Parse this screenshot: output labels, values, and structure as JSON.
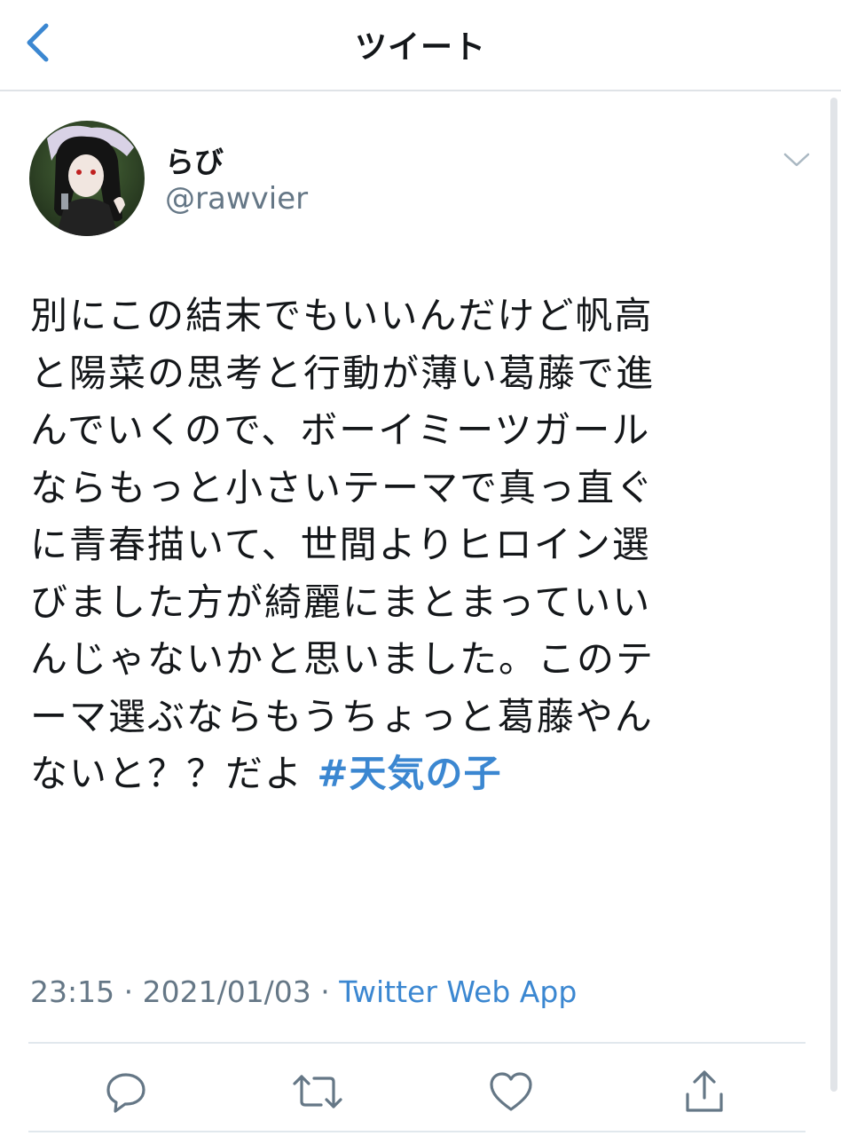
{
  "header": {
    "title": "ツイート",
    "back_icon": "chevron-left-icon"
  },
  "colors": {
    "accent": "#3b87d1",
    "text": "#14171a",
    "muted": "#657786",
    "divider": "#e1e8ed"
  },
  "tweet": {
    "author": {
      "display_name": "らび",
      "handle": "@rawvier"
    },
    "text_lines": [
      "別にこの結末でもいいんだけど帆高",
      "と陽菜の思考と行動が薄い葛藤で進",
      "んでいくので、ボーイミーツガール",
      "ならもっと小さいテーマで真っ直ぐ",
      "に青春描いて、世間よりヒロイン選",
      "びました方が綺麗にまとまっていい",
      "んじゃないかと思いました。このテ",
      "ーマ選ぶならもうちょっと葛藤やん",
      "ないと？？だよ "
    ],
    "hashtag": "#天気の子",
    "time": "23:15",
    "separator": " · ",
    "date": "2021/01/03",
    "source": "Twitter Web App"
  },
  "actions": [
    {
      "name": "reply",
      "icon": "reply-icon"
    },
    {
      "name": "retweet",
      "icon": "retweet-icon"
    },
    {
      "name": "like",
      "icon": "heart-icon"
    },
    {
      "name": "share",
      "icon": "share-icon"
    }
  ]
}
